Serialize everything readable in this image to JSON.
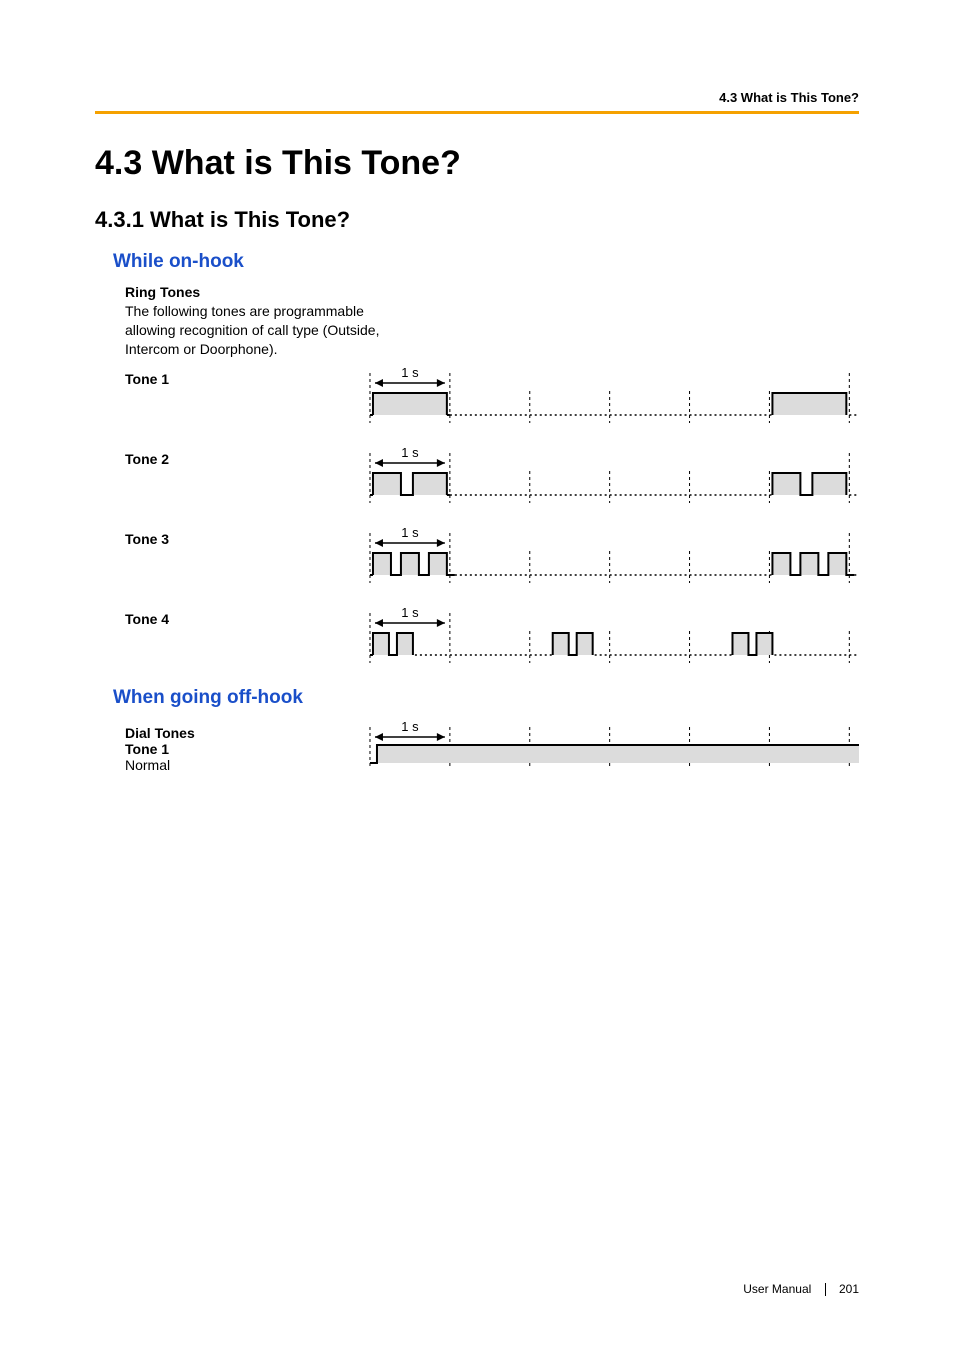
{
  "breadcrumb": "4.3 What is This Tone?",
  "h1": "4.3    What is This Tone?",
  "h2": "4.3.1    What is This Tone?",
  "sections": {
    "on_hook": {
      "title": "While on-hook",
      "ring_tones_title": "Ring Tones",
      "ring_tones_desc": "The following tones are programmable allowing recognition of call type (Outside, Intercom or Doorphone).",
      "tone1_label": "Tone 1",
      "tone2_label": "Tone 2",
      "tone3_label": "Tone 3",
      "tone4_label": "Tone 4",
      "time_label": "1 s"
    },
    "off_hook": {
      "title": "When going off-hook",
      "dial_tones_title": "Dial Tones",
      "tone1_label": "Tone 1",
      "tone1_sub": "Normal",
      "time_label": "1 s"
    }
  },
  "footer": {
    "manual": "User Manual",
    "page": "201"
  },
  "chart_data": [
    {
      "type": "waveform",
      "name": "Ring Tone 1",
      "period_shown_s": 6,
      "label_interval_s": 1,
      "grid_lines_s": 1,
      "pattern_note": "long on, then long off gap; repeats",
      "pulses_s": [
        {
          "start": 0.05,
          "end": 0.95
        },
        {
          "start": 5.05,
          "end": 5.95
        }
      ]
    },
    {
      "type": "waveform",
      "name": "Ring Tone 2",
      "period_shown_s": 6,
      "label_interval_s": 1,
      "grid_lines_s": 1,
      "pattern_note": "double pulse, long gap; repeats",
      "pulses_s": [
        {
          "start": 0.05,
          "end": 0.4
        },
        {
          "start": 0.55,
          "end": 0.95
        },
        {
          "start": 5.05,
          "end": 5.4
        },
        {
          "start": 5.55,
          "end": 5.95
        }
      ]
    },
    {
      "type": "waveform",
      "name": "Ring Tone 3",
      "period_shown_s": 6,
      "label_interval_s": 1,
      "grid_lines_s": 1,
      "pattern_note": "triple pulse, long gap; repeats",
      "pulses_s": [
        {
          "start": 0.05,
          "end": 0.28
        },
        {
          "start": 0.4,
          "end": 0.63
        },
        {
          "start": 0.75,
          "end": 0.98
        },
        {
          "start": 5.05,
          "end": 5.28
        },
        {
          "start": 5.4,
          "end": 5.63
        },
        {
          "start": 5.75,
          "end": 5.98
        }
      ]
    },
    {
      "type": "waveform",
      "name": "Ring Tone 4",
      "period_shown_s": 6,
      "label_interval_s": 1,
      "grid_lines_s": 1,
      "pattern_note": "two double-pulse groups within the visible window, repeating",
      "pulses_s": [
        {
          "start": 0.05,
          "end": 0.25
        },
        {
          "start": 0.35,
          "end": 0.55
        },
        {
          "start": 2.3,
          "end": 2.5
        },
        {
          "start": 2.6,
          "end": 2.8
        },
        {
          "start": 4.55,
          "end": 4.75
        },
        {
          "start": 4.85,
          "end": 5.05
        }
      ]
    },
    {
      "type": "waveform",
      "name": "Dial Tone 1",
      "period_shown_s": 6,
      "label_interval_s": 1,
      "grid_lines_s": 1,
      "pattern_note": "continuous tone",
      "pulses_s": [
        {
          "start": 0.08,
          "end": 6.0
        }
      ]
    }
  ]
}
